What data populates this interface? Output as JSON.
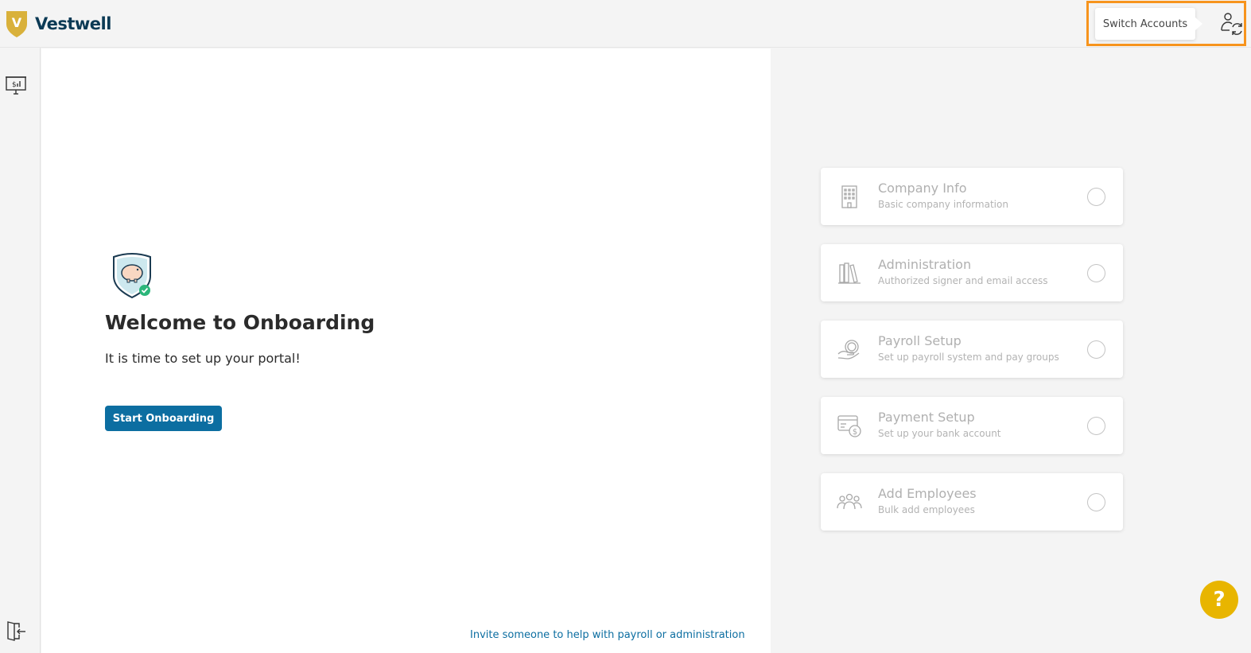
{
  "brand": {
    "logo_letter": "V",
    "name": "Vestwell",
    "colors": {
      "shield": "#d9b13b",
      "text": "#0b3a55"
    }
  },
  "header": {
    "switch_accounts_tooltip": "Switch Accounts",
    "switch_icon": "user-switch-icon",
    "highlight_color": "#f7941d"
  },
  "sidebar": {
    "items": [
      {
        "icon": "presentation-dollar-icon"
      },
      {
        "icon": "logout-door-icon"
      }
    ]
  },
  "main": {
    "hero_icon": "piggy-bank-shield-icon",
    "title": "Welcome to Onboarding",
    "subtitle": "It is time to set up your portal!",
    "start_button": "Start Onboarding",
    "invite_link": "Invite someone to help with payroll or administration",
    "accent_color": "#0c6ea1"
  },
  "steps": [
    {
      "icon": "building-icon",
      "title": "Company Info",
      "subtitle": "Basic company information"
    },
    {
      "icon": "books-icon",
      "title": "Administration",
      "subtitle": "Authorized signer and email access"
    },
    {
      "icon": "hand-coin-icon",
      "title": "Payroll Setup",
      "subtitle": "Set up payroll system and pay groups"
    },
    {
      "icon": "bank-card-icon",
      "title": "Payment Setup",
      "subtitle": "Set up your bank account"
    },
    {
      "icon": "people-group-icon",
      "title": "Add Employees",
      "subtitle": "Bulk add employees"
    }
  ],
  "help": {
    "label": "?",
    "color": "#e8b500"
  }
}
